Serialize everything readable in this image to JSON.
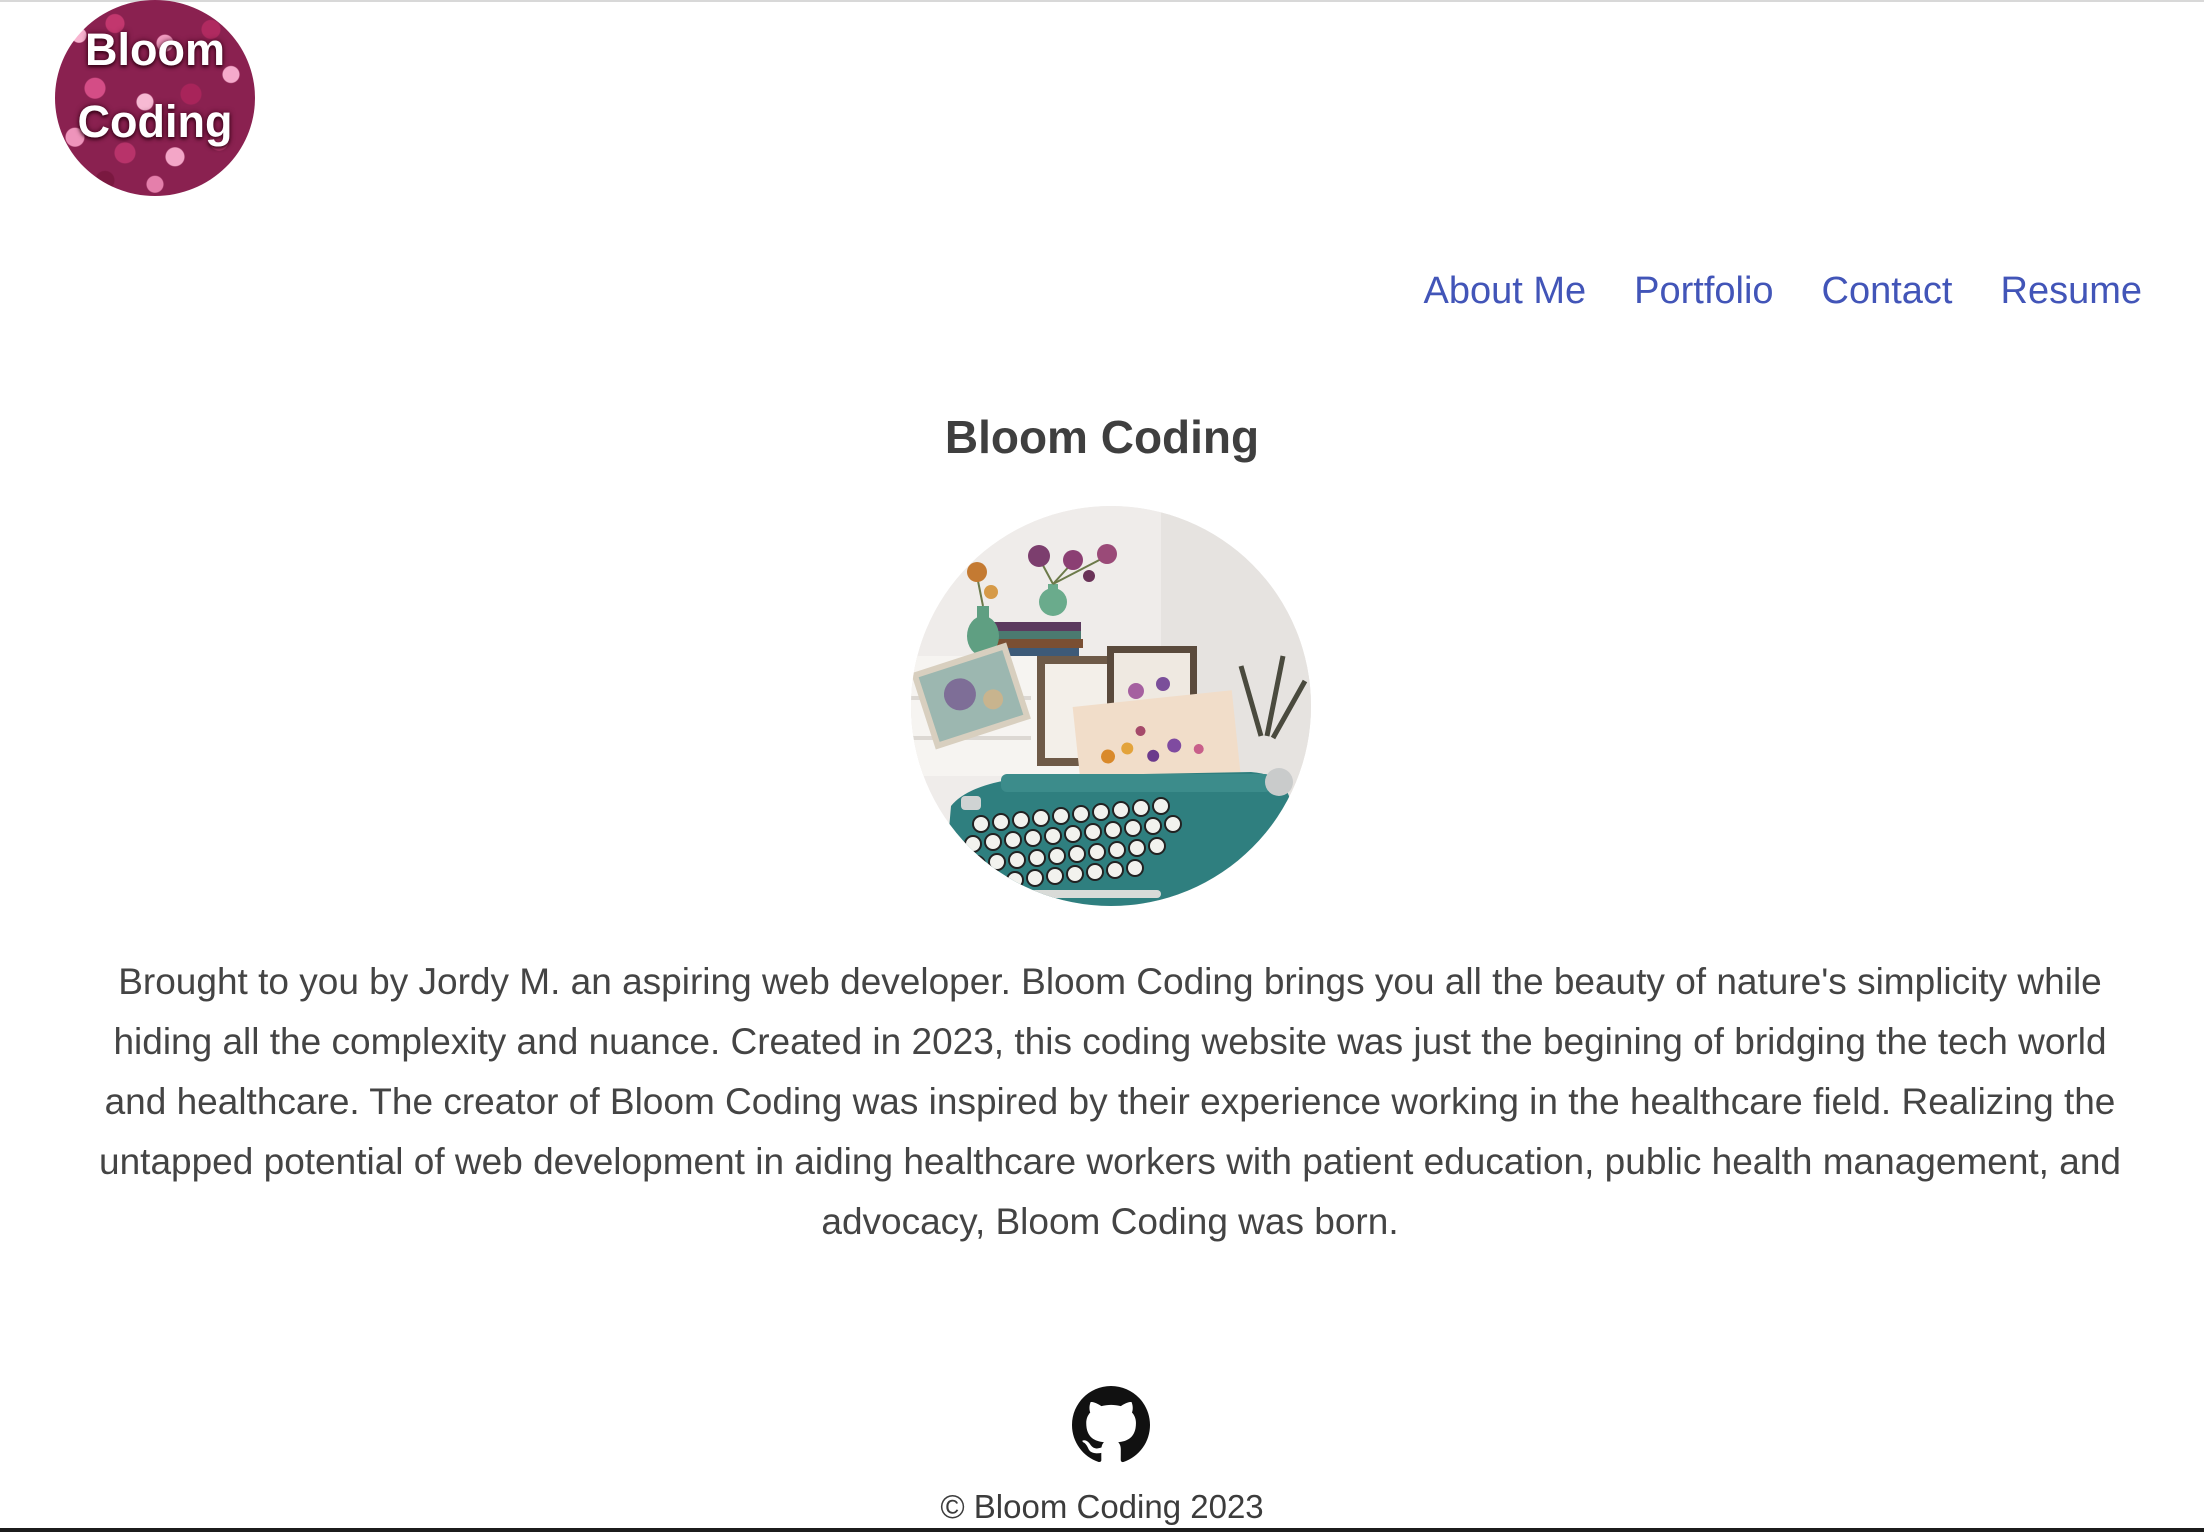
{
  "header": {
    "logo_line1": "Bloom",
    "logo_line2": "Coding"
  },
  "nav": {
    "items": [
      {
        "label": "About Me"
      },
      {
        "label": "Portfolio"
      },
      {
        "label": "Contact"
      },
      {
        "label": "Resume"
      }
    ]
  },
  "main": {
    "title": "Bloom Coding",
    "hero_icon": "typewriter-with-flowers-image",
    "about_text": "Brought to you by Jordy M. an aspiring web developer. Bloom Coding brings you all the beauty of nature's simplicity while hiding all the complexity and nuance. Created in 2023, this coding website was just the begining of bridging the tech world and healthcare. The creator of Bloom Coding was inspired by their experience working in the healthcare field. Realizing the untapped potential of web development in aiding healthcare workers with patient education, public health management, and advocacy, Bloom Coding was born."
  },
  "footer": {
    "github_icon": "github-icon",
    "copyright": "© Bloom Coding 2023"
  },
  "colors": {
    "nav_link": "#4255b8",
    "text": "#444444",
    "logo_bg": "#8a2150"
  }
}
